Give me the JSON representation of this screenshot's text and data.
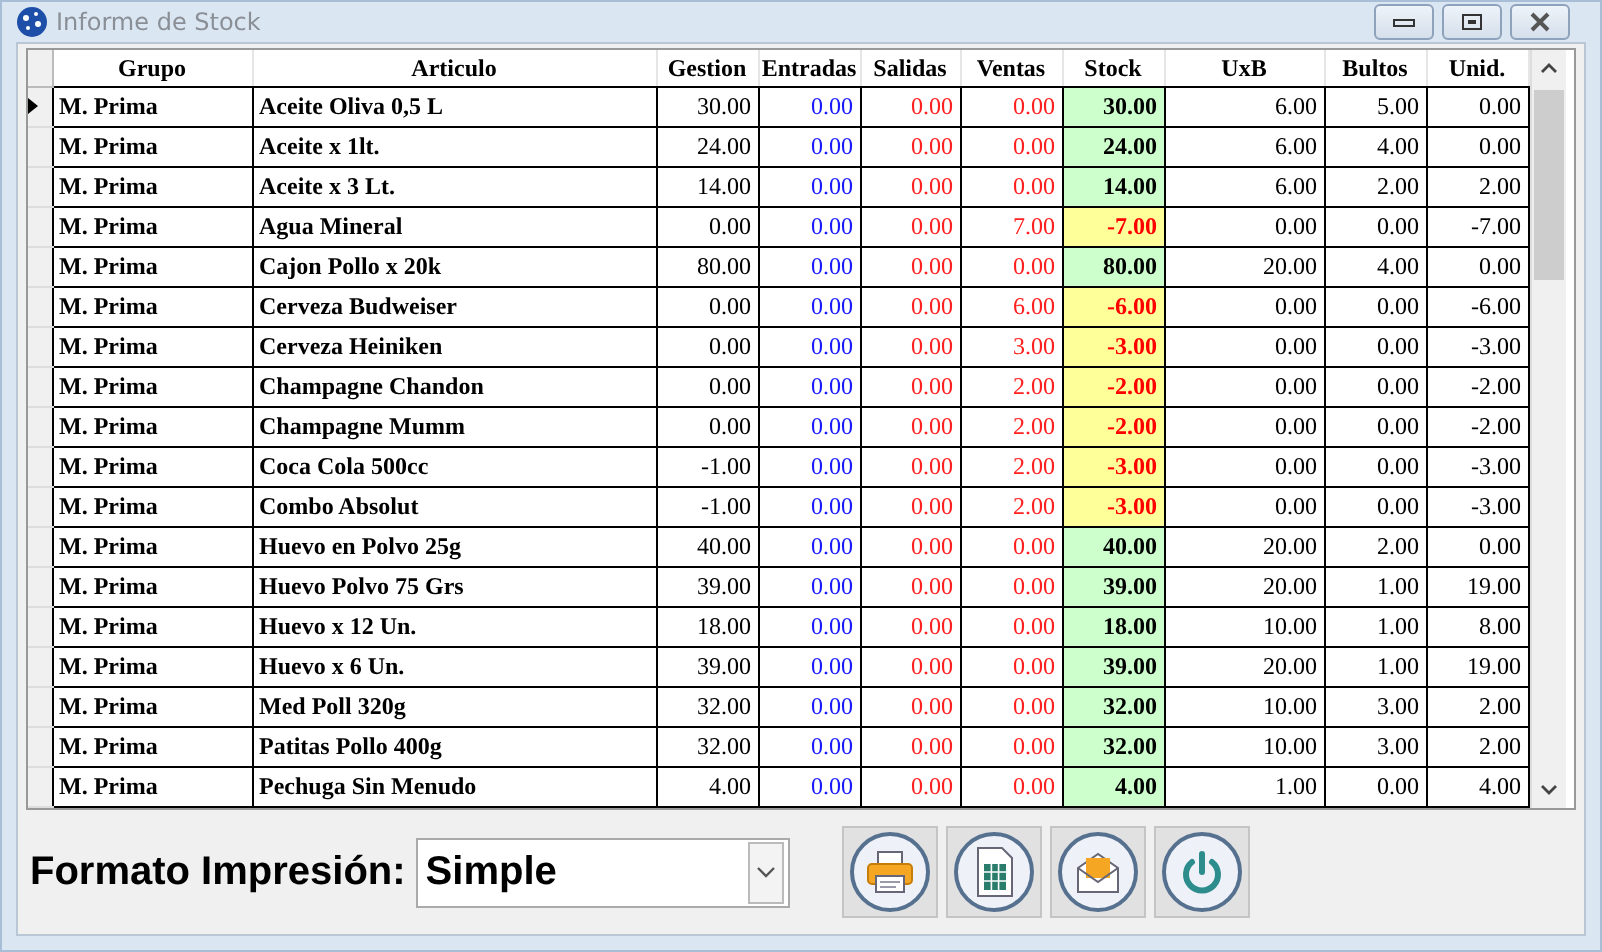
{
  "window": {
    "title": "Informe de Stock"
  },
  "table": {
    "columns": [
      "Grupo",
      "Articulo",
      "Gestion",
      "Entradas",
      "Salidas",
      "Ventas",
      "Stock",
      "UxB",
      "Bultos",
      "Unid."
    ],
    "rows": [
      {
        "selected": true,
        "color": "#ccffcc",
        "cells": [
          "M. Prima",
          "Aceite Oliva 0,5 L",
          "30.00",
          "0.00",
          "0.00",
          "0.00",
          "30.00",
          "6.00",
          "5.00",
          "0.00"
        ]
      },
      {
        "selected": false,
        "color": "#ccffcc",
        "cells": [
          "M. Prima",
          "Aceite x 1lt.",
          "24.00",
          "0.00",
          "0.00",
          "0.00",
          "24.00",
          "6.00",
          "4.00",
          "0.00"
        ]
      },
      {
        "selected": false,
        "color": "#ccffcc",
        "cells": [
          "M. Prima",
          "Aceite x 3 Lt.",
          "14.00",
          "0.00",
          "0.00",
          "0.00",
          "14.00",
          "6.00",
          "2.00",
          "2.00"
        ]
      },
      {
        "selected": false,
        "color": "#ffff99",
        "cells": [
          "M. Prima",
          "Agua Mineral",
          "0.00",
          "0.00",
          "0.00",
          "7.00",
          "-7.00",
          "0.00",
          "0.00",
          "-7.00"
        ]
      },
      {
        "selected": false,
        "color": "#ccffcc",
        "cells": [
          "M. Prima",
          "Cajon Pollo x 20k",
          "80.00",
          "0.00",
          "0.00",
          "0.00",
          "80.00",
          "20.00",
          "4.00",
          "0.00"
        ]
      },
      {
        "selected": false,
        "color": "#ffff99",
        "cells": [
          "M. Prima",
          "Cerveza Budweiser",
          "0.00",
          "0.00",
          "0.00",
          "6.00",
          "-6.00",
          "0.00",
          "0.00",
          "-6.00"
        ]
      },
      {
        "selected": false,
        "color": "#ffff99",
        "cells": [
          "M. Prima",
          "Cerveza Heiniken",
          "0.00",
          "0.00",
          "0.00",
          "3.00",
          "-3.00",
          "0.00",
          "0.00",
          "-3.00"
        ]
      },
      {
        "selected": false,
        "color": "#ffff99",
        "cells": [
          "M. Prima",
          "Champagne Chandon",
          "0.00",
          "0.00",
          "0.00",
          "2.00",
          "-2.00",
          "0.00",
          "0.00",
          "-2.00"
        ]
      },
      {
        "selected": false,
        "color": "#ffff99",
        "cells": [
          "M. Prima",
          "Champagne Mumm",
          "0.00",
          "0.00",
          "0.00",
          "2.00",
          "-2.00",
          "0.00",
          "0.00",
          "-2.00"
        ]
      },
      {
        "selected": false,
        "color": "#ffff99",
        "cells": [
          "M. Prima",
          "Coca Cola 500cc",
          "-1.00",
          "0.00",
          "0.00",
          "2.00",
          "-3.00",
          "0.00",
          "0.00",
          "-3.00"
        ]
      },
      {
        "selected": false,
        "color": "#ffff99",
        "cells": [
          "M. Prima",
          "Combo Absolut",
          "-1.00",
          "0.00",
          "0.00",
          "2.00",
          "-3.00",
          "0.00",
          "0.00",
          "-3.00"
        ]
      },
      {
        "selected": false,
        "color": "#ccffcc",
        "cells": [
          "M. Prima",
          "Huevo en Polvo 25g",
          "40.00",
          "0.00",
          "0.00",
          "0.00",
          "40.00",
          "20.00",
          "2.00",
          "0.00"
        ]
      },
      {
        "selected": false,
        "color": "#ccffcc",
        "cells": [
          "M. Prima",
          "Huevo Polvo 75 Grs",
          "39.00",
          "0.00",
          "0.00",
          "0.00",
          "39.00",
          "20.00",
          "1.00",
          "19.00"
        ]
      },
      {
        "selected": false,
        "color": "#ccffcc",
        "cells": [
          "M. Prima",
          "Huevo x 12 Un.",
          "18.00",
          "0.00",
          "0.00",
          "0.00",
          "18.00",
          "10.00",
          "1.00",
          "8.00"
        ]
      },
      {
        "selected": false,
        "color": "#ccffcc",
        "cells": [
          "M. Prima",
          "Huevo x 6 Un.",
          "39.00",
          "0.00",
          "0.00",
          "0.00",
          "39.00",
          "20.00",
          "1.00",
          "19.00"
        ]
      },
      {
        "selected": false,
        "color": "#ccffcc",
        "cells": [
          "M. Prima",
          "Med Poll 320g",
          "32.00",
          "0.00",
          "0.00",
          "0.00",
          "32.00",
          "10.00",
          "3.00",
          "2.00"
        ]
      },
      {
        "selected": false,
        "color": "#ccffcc",
        "cells": [
          "M. Prima",
          "Patitas Pollo 400g",
          "32.00",
          "0.00",
          "0.00",
          "0.00",
          "32.00",
          "10.00",
          "3.00",
          "2.00"
        ]
      },
      {
        "selected": false,
        "color": "#ccffcc",
        "cells": [
          "M. Prima",
          "Pechuga Sin Menudo",
          "4.00",
          "0.00",
          "0.00",
          "0.00",
          "4.00",
          "1.00",
          "0.00",
          "4.00"
        ]
      }
    ]
  },
  "format": {
    "label": "Formato Impresión:",
    "value": "Simple"
  },
  "actions": [
    {
      "kind": "print"
    },
    {
      "kind": "spreadsheet"
    },
    {
      "kind": "email"
    },
    {
      "kind": "exit"
    }
  ]
}
